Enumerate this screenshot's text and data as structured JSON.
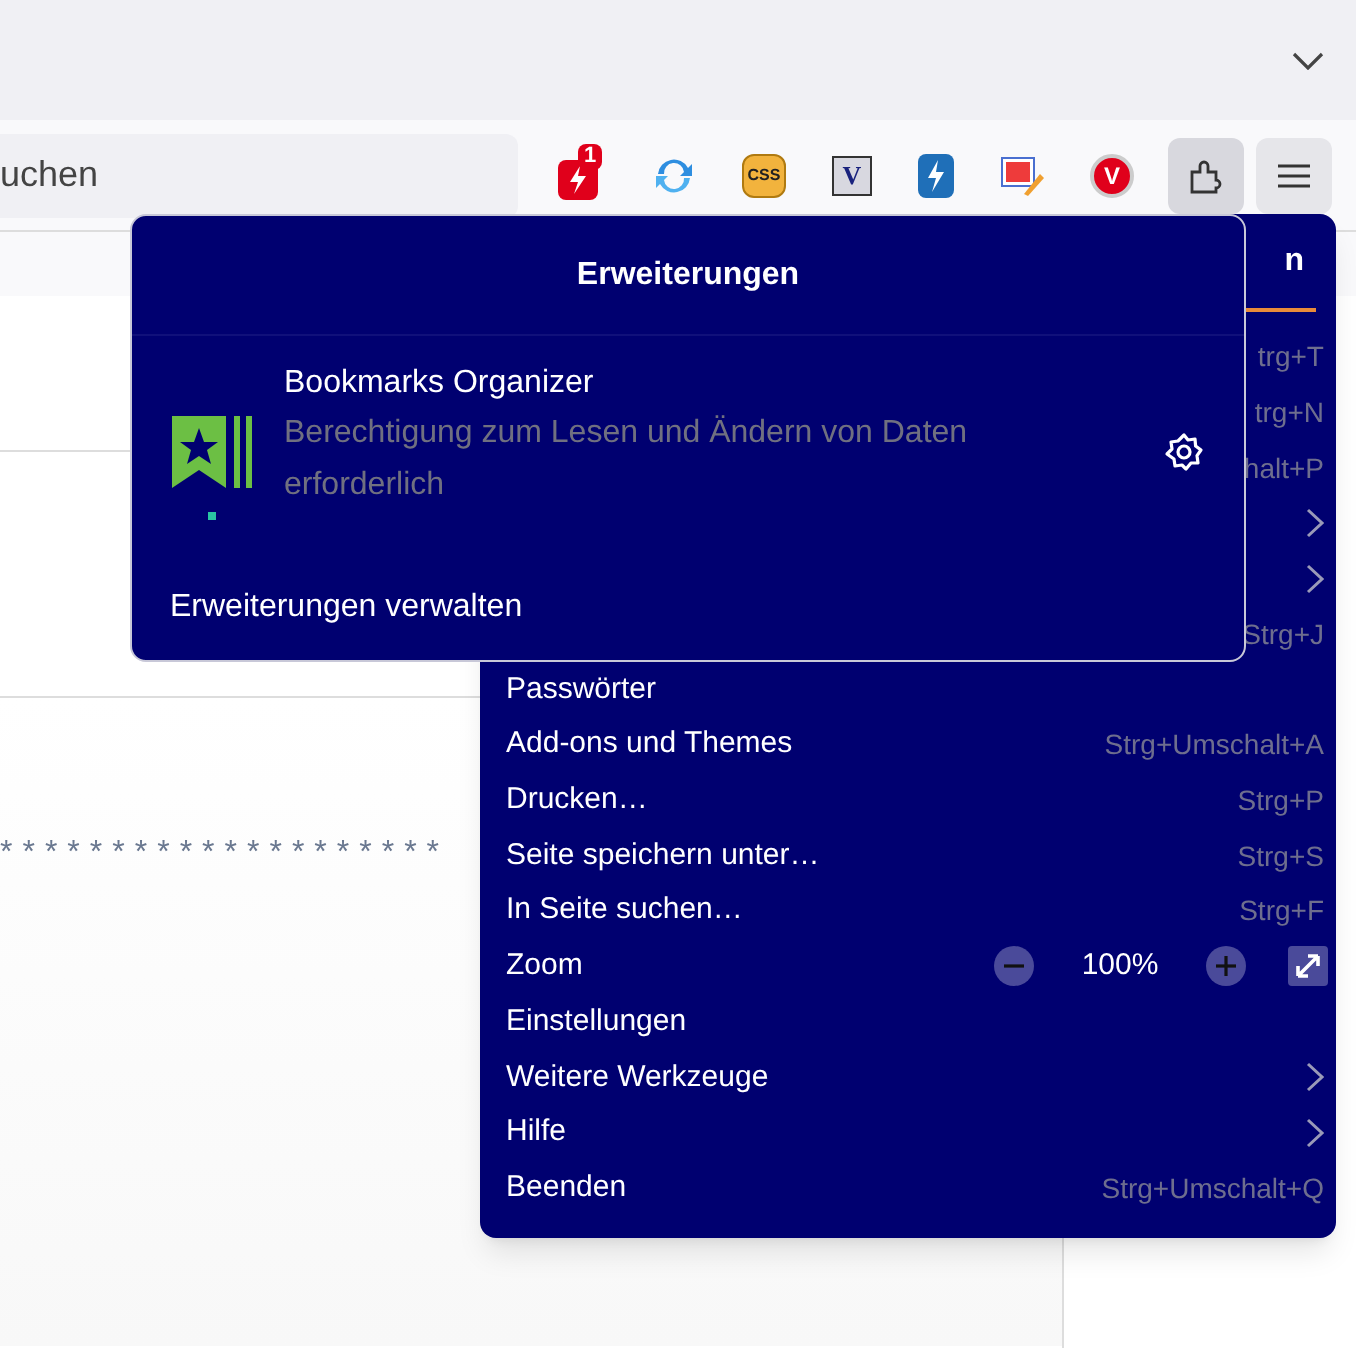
{
  "toolbar": {
    "search_field": {
      "value": "uchen"
    },
    "extension_icons": [
      {
        "kind": "alert",
        "badge": "1"
      },
      {
        "kind": "sync"
      },
      {
        "kind": "css",
        "label": "CSS"
      },
      {
        "kind": "box-letter",
        "label": "V"
      },
      {
        "kind": "bolt"
      },
      {
        "kind": "image-edit"
      },
      {
        "kind": "circle-letter",
        "label": "V"
      }
    ],
    "extensions_button": {
      "selected": true
    }
  },
  "page": {
    "asterisk_line": "********************"
  },
  "main_menu": {
    "heading": "n",
    "items": [
      {
        "kind": "item",
        "shortcut": "trg+T"
      },
      {
        "kind": "item",
        "shortcut": "trg+N"
      },
      {
        "kind": "item",
        "shortcut": "halt+P"
      },
      {
        "kind": "submenu"
      },
      {
        "kind": "submenu"
      },
      {
        "kind": "item",
        "shortcut": "Strg+J"
      },
      {
        "kind": "item",
        "label": "Passwörter"
      },
      {
        "kind": "item",
        "label": "Add-ons und Themes",
        "shortcut": "Strg+Umschalt+A"
      },
      {
        "kind": "item",
        "label": "Drucken…",
        "shortcut": "Strg+P"
      },
      {
        "kind": "item",
        "label": "Seite speichern unter…",
        "shortcut": "Strg+S"
      },
      {
        "kind": "item",
        "label": "In Seite suchen…",
        "shortcut": "Strg+F"
      },
      {
        "kind": "zoom",
        "label": "Zoom",
        "value": "100%"
      },
      {
        "kind": "item",
        "label": "Einstellungen"
      },
      {
        "kind": "submenu",
        "label": "Weitere Werkzeuge"
      },
      {
        "kind": "submenu",
        "label": "Hilfe"
      },
      {
        "kind": "item",
        "label": "Beenden",
        "shortcut": "Strg+Umschalt+Q"
      }
    ]
  },
  "extensions_panel": {
    "title": "Erweiterungen",
    "extensions": [
      {
        "name": "Bookmarks Organizer",
        "description": "Berechtigung zum Lesen und Ändern von Daten erforderlich"
      }
    ],
    "manage_link": "Erweiterungen verwalten"
  }
}
